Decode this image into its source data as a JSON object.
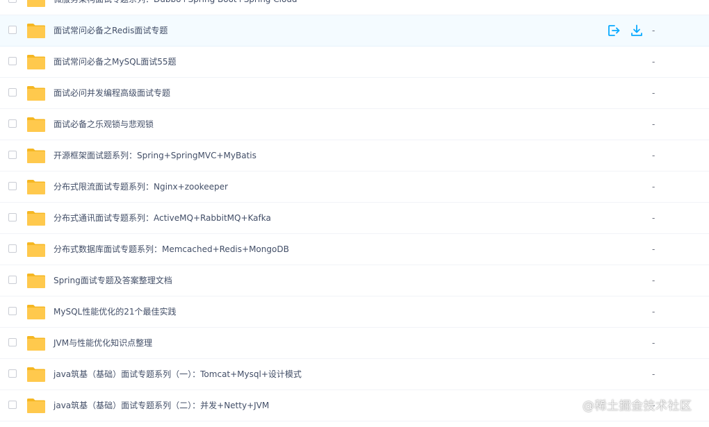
{
  "colors": {
    "folder": "#ffc94d",
    "folder_dark": "#f5b722",
    "accent_blue": "#09aaff",
    "hover_row": "#f4fbff"
  },
  "actions": {
    "share_icon": "share-icon",
    "download_icon": "download-icon"
  },
  "files": [
    {
      "name": "微服务架构面试专题系列：Dubbo+Spring Boot+Spring Cloud",
      "size": "-",
      "hover": false
    },
    {
      "name": "面试常问必备之Redis面试专题",
      "size": "-",
      "hover": true
    },
    {
      "name": "面试常问必备之MySQL面试55题",
      "size": "-",
      "hover": false
    },
    {
      "name": "面试必问并发编程高级面试专题",
      "size": "-",
      "hover": false
    },
    {
      "name": "面试必备之乐观锁与悲观锁",
      "size": "-",
      "hover": false
    },
    {
      "name": "开源框架面试题系列：Spring+SpringMVC+MyBatis",
      "size": "-",
      "hover": false
    },
    {
      "name": "分布式限流面试专题系列：Nginx+zookeeper",
      "size": "-",
      "hover": false
    },
    {
      "name": "分布式通讯面试专题系列：ActiveMQ+RabbitMQ+Kafka",
      "size": "-",
      "hover": false
    },
    {
      "name": "分布式数据库面试专题系列：Memcached+Redis+MongoDB",
      "size": "-",
      "hover": false
    },
    {
      "name": "Spring面试专题及答案整理文档",
      "size": "-",
      "hover": false
    },
    {
      "name": "MySQL性能优化的21个最佳实践",
      "size": "-",
      "hover": false
    },
    {
      "name": "JVM与性能优化知识点整理",
      "size": "-",
      "hover": false
    },
    {
      "name": "java筑基（基础）面试专题系列（一）：Tomcat+Mysql+设计模式",
      "size": "-",
      "hover": false
    },
    {
      "name": "java筑基（基础）面试专题系列（二）：并发+Netty+JVM",
      "size": "-",
      "hover": false
    }
  ],
  "watermark": "@稀土掘金技术社区"
}
